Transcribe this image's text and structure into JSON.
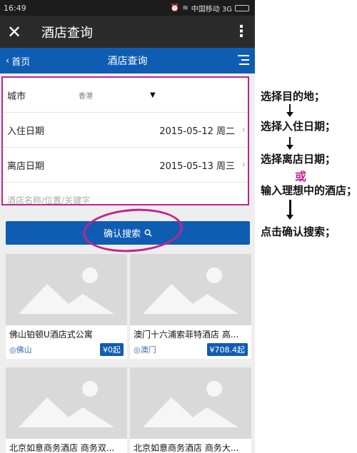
{
  "status_bar": {
    "time": "16:49",
    "carrier": "中国移动 3G"
  },
  "wechat_bar": {
    "title": "酒店查询"
  },
  "nav": {
    "back_label": "首页",
    "title": "酒店查询"
  },
  "form": {
    "city_label": "城市",
    "city_value": "香港",
    "checkin_label": "入住日期",
    "checkin_value": "2015-05-12 周二",
    "checkout_label": "离店日期",
    "checkout_value": "2015-05-13 周三",
    "keyword_placeholder": "酒店名称/位置/关键字"
  },
  "search_button_label": "确认搜索",
  "hotels": [
    {
      "name": "佛山铂顿U酒店式公寓",
      "location": "佛山",
      "price": "¥0起"
    },
    {
      "name": "澳门十六浦索菲特酒店 高...",
      "location": "澳门",
      "price": "¥708.4起"
    },
    {
      "name": "北京如意商务酒店 商务双...",
      "location": "",
      "price": ""
    },
    {
      "name": "北京如意商务酒店 商务大...",
      "location": "",
      "price": ""
    }
  ],
  "annotations": {
    "step1": "选择目的地；",
    "step2": "选择入住日期；",
    "step3": "选择离店日期；",
    "or": "或",
    "step4": "输入理想中的酒店；",
    "step5": "点击确认搜索；"
  },
  "colors": {
    "nav_blue": "#0f5db3",
    "highlight_magenta": "#c1248d"
  }
}
